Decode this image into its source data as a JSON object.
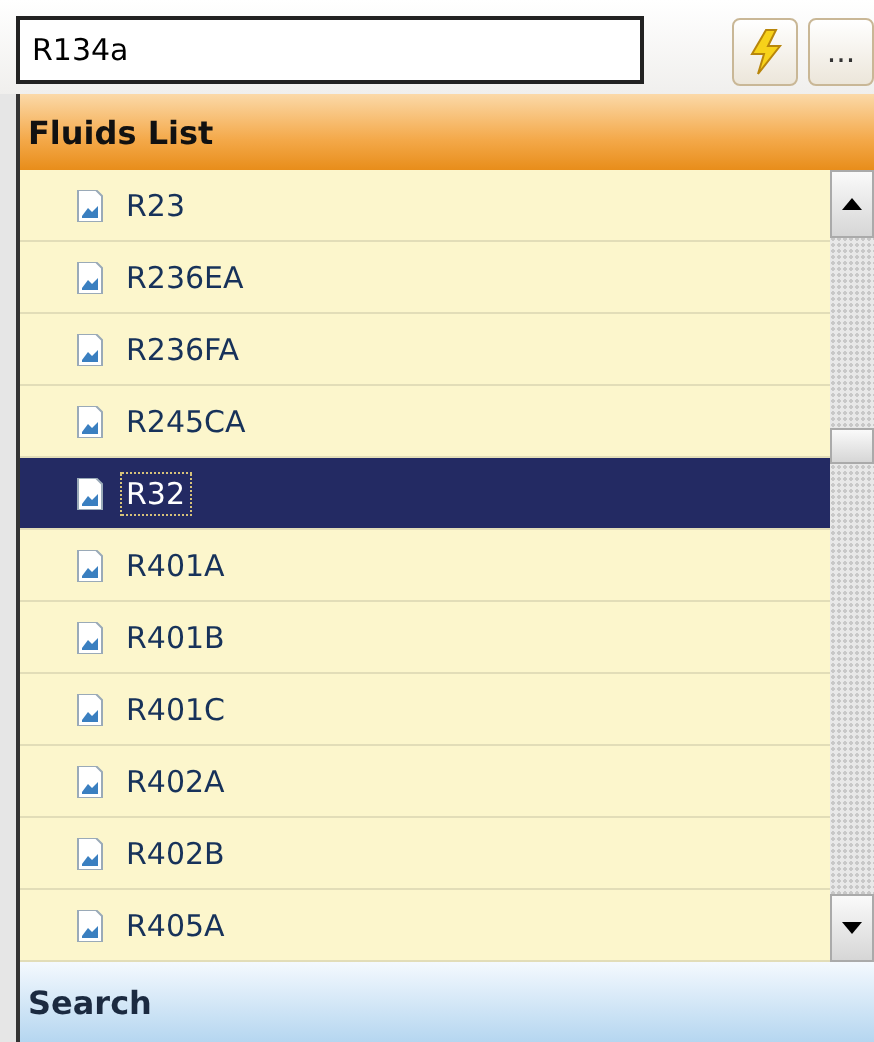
{
  "fluid_field": {
    "value": "R134a"
  },
  "buttons": [
    {
      "kind": "lightning"
    },
    {
      "kind": "ellipsis",
      "label": "..."
    }
  ],
  "fluids_list": {
    "title": "Fluids List",
    "items": [
      {
        "label": "R23",
        "selected": false
      },
      {
        "label": "R236EA",
        "selected": false
      },
      {
        "label": "R236FA",
        "selected": false
      },
      {
        "label": "R245CA",
        "selected": false
      },
      {
        "label": "R32",
        "selected": true
      },
      {
        "label": "R401A",
        "selected": false
      },
      {
        "label": "R401B",
        "selected": false
      },
      {
        "label": "R401C",
        "selected": false
      },
      {
        "label": "R402A",
        "selected": false
      },
      {
        "label": "R402B",
        "selected": false
      },
      {
        "label": "R405A",
        "selected": false
      }
    ]
  },
  "search_panel": {
    "title": "Search"
  }
}
